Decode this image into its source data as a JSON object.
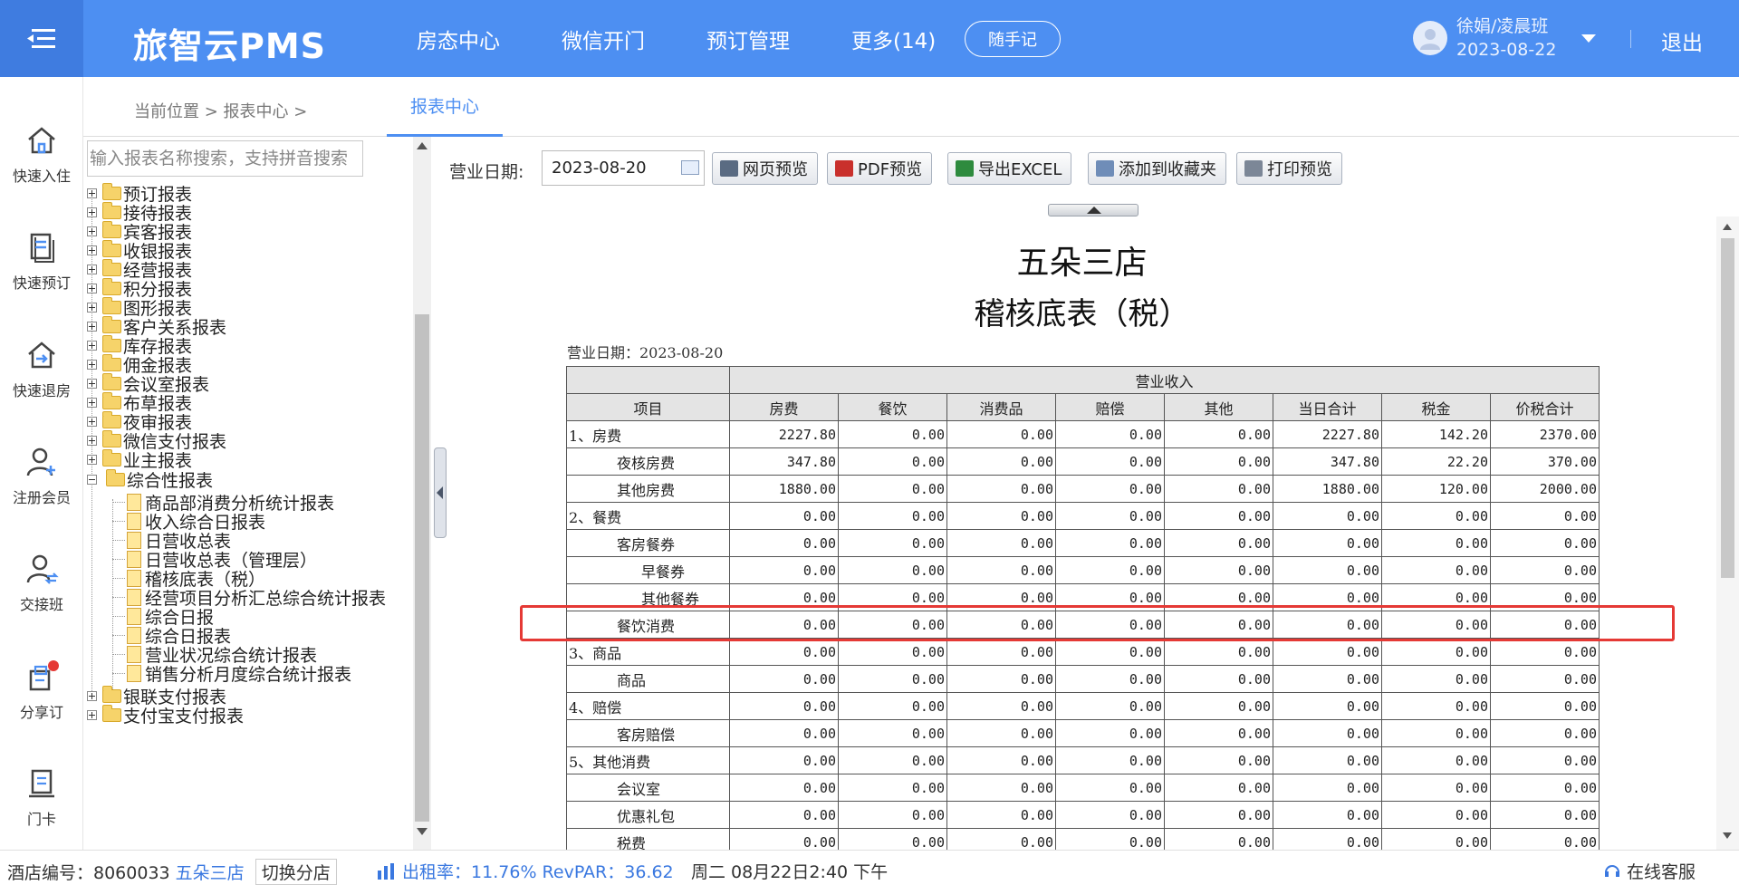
{
  "header": {
    "brand": "旅智云PMS",
    "nav": [
      "房态中心",
      "微信开门",
      "预订管理",
      "更多(14)"
    ],
    "memo_button": "随手记",
    "user_name": "徐娟/凌晨班",
    "user_date": "2023-08-22",
    "logout": "退出",
    "accent": "#4d8ff2"
  },
  "sidebar": {
    "items": [
      {
        "label": "快速入住",
        "icon": "home-icon"
      },
      {
        "label": "快速预订",
        "icon": "booking-icon"
      },
      {
        "label": "快速退房",
        "icon": "checkout-icon"
      },
      {
        "label": "注册会员",
        "icon": "add-member-icon"
      },
      {
        "label": "交接班",
        "icon": "handover-icon"
      },
      {
        "label": "分享订",
        "icon": "share-order-icon"
      },
      {
        "label": "门卡",
        "icon": "door-card-icon"
      }
    ]
  },
  "breadcrumb": {
    "text": "当前位置 > 报表中心 >",
    "active_tab": "报表中心"
  },
  "tree": {
    "search_placeholder": "输入报表名称搜索，支持拼音搜索",
    "top_level": [
      "预订报表",
      "接待报表",
      "宾客报表",
      "收银报表",
      "经营报表",
      "积分报表",
      "图形报表",
      "客户关系报表",
      "库存报表",
      "佣金报表",
      "会议室报表",
      "布草报表",
      "夜审报表",
      "微信支付报表",
      "业主报表"
    ],
    "expanded": "综合性报表",
    "children": [
      "商品部消费分析统计报表",
      "收入综合日报表",
      "日营收总表",
      "日营收总表（管理层）",
      "稽核底表（税）",
      "经营项目分析汇总综合统计报表",
      "综合日报",
      "综合日报表",
      "营业状况综合统计报表",
      "销售分析月度综合统计报表"
    ],
    "after": [
      "银联支付报表",
      "支付宝支付报表"
    ]
  },
  "toolbar": {
    "date_label": "营业日期:",
    "date_value": "2023-08-20",
    "buttons": [
      "网页预览",
      "PDF预览",
      "导出EXCEL",
      "添加到收藏夹",
      "打印预览"
    ]
  },
  "report": {
    "hotel": "五朵三店",
    "title": "稽核底表（税）",
    "date_line": "营业日期：2023-08-20",
    "group_header": "营业收入",
    "columns": [
      "项目",
      "房费",
      "餐饮",
      "消费品",
      "赔偿",
      "其他",
      "当日合计",
      "税金",
      "价税合计"
    ],
    "rows": [
      {
        "level": 1,
        "name": "1、房费",
        "values": [
          "2227.80",
          "0.00",
          "0.00",
          "0.00",
          "0.00",
          "2227.80",
          "142.20",
          "2370.00"
        ]
      },
      {
        "level": 2,
        "name": "夜核房费",
        "values": [
          "347.80",
          "0.00",
          "0.00",
          "0.00",
          "0.00",
          "347.80",
          "22.20",
          "370.00"
        ]
      },
      {
        "level": 2,
        "name": "其他房费",
        "values": [
          "1880.00",
          "0.00",
          "0.00",
          "0.00",
          "0.00",
          "1880.00",
          "120.00",
          "2000.00"
        ]
      },
      {
        "level": 1,
        "name": "2、餐费",
        "values": [
          "0.00",
          "0.00",
          "0.00",
          "0.00",
          "0.00",
          "0.00",
          "0.00",
          "0.00"
        ]
      },
      {
        "level": 2,
        "name": "客房餐券",
        "values": [
          "0.00",
          "0.00",
          "0.00",
          "0.00",
          "0.00",
          "0.00",
          "0.00",
          "0.00"
        ]
      },
      {
        "level": 3,
        "name": "早餐券",
        "values": [
          "0.00",
          "0.00",
          "0.00",
          "0.00",
          "0.00",
          "0.00",
          "0.00",
          "0.00"
        ]
      },
      {
        "level": 3,
        "name": "其他餐券",
        "values": [
          "0.00",
          "0.00",
          "0.00",
          "0.00",
          "0.00",
          "0.00",
          "0.00",
          "0.00"
        ]
      },
      {
        "level": 2,
        "name": "餐饮消费",
        "values": [
          "0.00",
          "0.00",
          "0.00",
          "0.00",
          "0.00",
          "0.00",
          "0.00",
          "0.00"
        ]
      },
      {
        "level": 1,
        "name": "3、商品",
        "values": [
          "0.00",
          "0.00",
          "0.00",
          "0.00",
          "0.00",
          "0.00",
          "0.00",
          "0.00"
        ]
      },
      {
        "level": 2,
        "name": "商品",
        "values": [
          "0.00",
          "0.00",
          "0.00",
          "0.00",
          "0.00",
          "0.00",
          "0.00",
          "0.00"
        ]
      },
      {
        "level": 1,
        "name": "4、赔偿",
        "values": [
          "0.00",
          "0.00",
          "0.00",
          "0.00",
          "0.00",
          "0.00",
          "0.00",
          "0.00"
        ]
      },
      {
        "level": 2,
        "name": "客房赔偿",
        "values": [
          "0.00",
          "0.00",
          "0.00",
          "0.00",
          "0.00",
          "0.00",
          "0.00",
          "0.00"
        ]
      },
      {
        "level": 1,
        "name": "5、其他消费",
        "values": [
          "0.00",
          "0.00",
          "0.00",
          "0.00",
          "0.00",
          "0.00",
          "0.00",
          "0.00"
        ]
      },
      {
        "level": 2,
        "name": "会议室",
        "values": [
          "0.00",
          "0.00",
          "0.00",
          "0.00",
          "0.00",
          "0.00",
          "0.00",
          "0.00"
        ]
      },
      {
        "level": 2,
        "name": "优惠礼包",
        "values": [
          "0.00",
          "0.00",
          "0.00",
          "0.00",
          "0.00",
          "0.00",
          "0.00",
          "0.00"
        ]
      },
      {
        "level": 2,
        "name": "税费",
        "values": [
          "0.00",
          "0.00",
          "0.00",
          "0.00",
          "0.00",
          "0.00",
          "0.00",
          "0.00"
        ]
      }
    ],
    "highlight_color": "#e53935"
  },
  "statusbar": {
    "hotel_id_label": "酒店编号：8060033",
    "hotel_name": "五朵三店",
    "switch": "切换分店",
    "rate": "出租率：11.76% RevPAR：36.62",
    "time": "周二 08月22日2:40 下午",
    "service": "在线客服"
  }
}
